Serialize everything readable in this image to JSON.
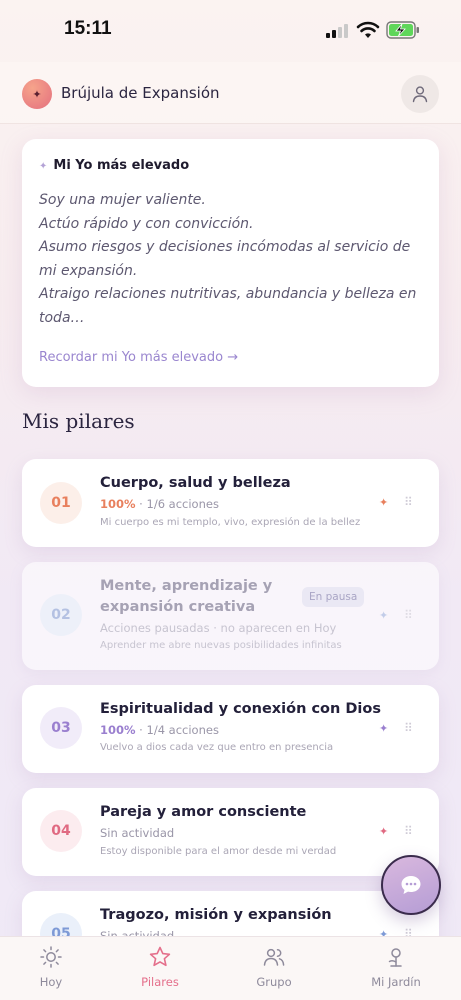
{
  "status_bar": {
    "time": "15:11"
  },
  "header": {
    "logo_glyph": "✦",
    "app_title": "Brújula de Expansión",
    "profile_icon": "user-icon"
  },
  "higher_self": {
    "heading": "Mi Yo más elevado",
    "lines": [
      "Soy una mujer valiente.",
      "Actúo rápido y con convicción.",
      "Asumo riesgos y decisiones incómodas al servicio de mi expansión.",
      "Atraigo relaciones nutritivas, abundancia y belleza en toda…"
    ],
    "link_label": "Recordar mi Yo más elevado →"
  },
  "pillars_section": {
    "title": "Mis pilares",
    "items": [
      {
        "number": "01",
        "title": "Cuerpo, salud y belleza",
        "progress_percent": "100%",
        "progress_rest": " · 1/6 acciones",
        "description": "Mi cuerpo es mi templo, vivo, expresión de la bellez…",
        "accent": "#e8805e",
        "num_bg": "#fcefe9",
        "state": "active"
      },
      {
        "number": "02",
        "title": "Mente, aprendizaje y expansión creativa",
        "badge": "En pausa",
        "progress_rest": "Acciones pausadas · no aparecen en Hoy",
        "description": "Aprender me abre nuevas posibilidades infinitas",
        "accent": "#9fb3de",
        "num_bg": "#edf0f9",
        "state": "paused"
      },
      {
        "number": "03",
        "title": "Espiritualidad y conexión con Dios",
        "progress_percent": "100%",
        "progress_rest": " · 1/4 acciones",
        "description": "Vuelvo a dios cada vez que entro en presencia",
        "accent": "#9a7fcf",
        "num_bg": "#f1ecf9",
        "state": "active"
      },
      {
        "number": "04",
        "title": "Pareja y amor consciente",
        "progress_rest": "Sin actividad",
        "description": "Estoy disponible para el amor desde mi verdad",
        "accent": "#e06a82",
        "num_bg": "#fcecef",
        "state": "active"
      },
      {
        "number": "05",
        "title": "Tragozo, misión y expansión",
        "progress_rest": "Sin actividad",
        "description": "",
        "accent": "#7e9ad6",
        "num_bg": "#eaf0fa",
        "state": "active"
      }
    ]
  },
  "chat_fab": {
    "icon": "chat-bubble-icon"
  },
  "bottom_nav": {
    "items": [
      {
        "label": "Hoy",
        "icon": "sun-icon"
      },
      {
        "label": "Pilares",
        "icon": "star-icon",
        "active": true
      },
      {
        "label": "Grupo",
        "icon": "people-icon"
      },
      {
        "label": "Mi Jardín",
        "icon": "plant-icon"
      }
    ]
  }
}
